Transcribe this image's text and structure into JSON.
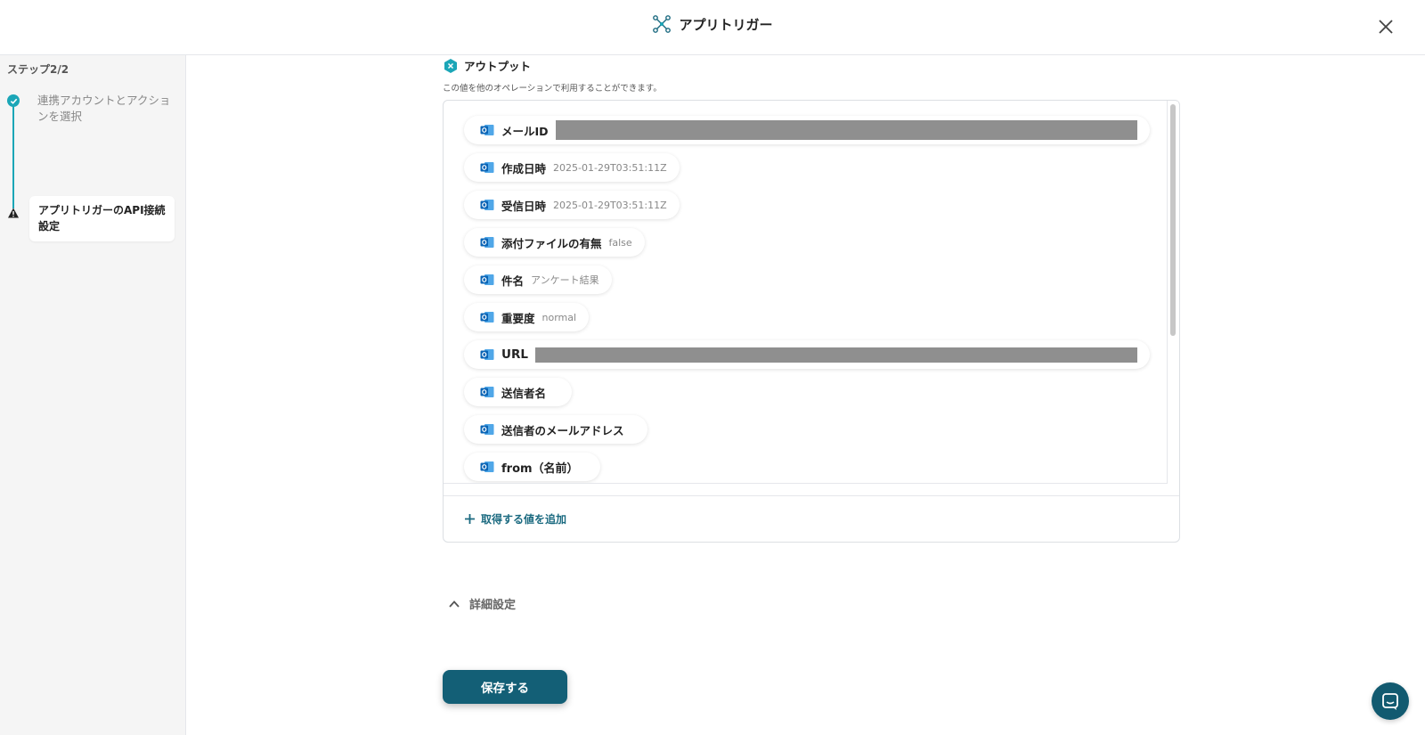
{
  "header": {
    "title": "アプリトリガー",
    "title_icon": "app-trigger-icon",
    "close_icon": "close-icon"
  },
  "sidebar": {
    "step_count": "ステップ2/2",
    "steps": [
      {
        "label": "連携アカウントとアクションを選択",
        "status": "completed",
        "icon": "check-icon"
      },
      {
        "label": "アプリトリガーのAPI接続設定",
        "status": "current",
        "icon": "warning-icon"
      }
    ]
  },
  "output": {
    "title": "アウトプット",
    "description": "この値を他のオペレーションで利用することができます。",
    "items": [
      {
        "label": "メールID",
        "value": "",
        "redacted": true
      },
      {
        "label": "作成日時",
        "value": "2025-01-29T03:51:11Z"
      },
      {
        "label": "受信日時",
        "value": "2025-01-29T03:51:11Z"
      },
      {
        "label": "添付ファイルの有無",
        "value": "false"
      },
      {
        "label": "件名",
        "value": "アンケート結果"
      },
      {
        "label": "重要度",
        "value": "normal"
      },
      {
        "label": "URL",
        "value": "",
        "redacted": true
      },
      {
        "label": "送信者名",
        "value": ""
      },
      {
        "label": "送信者のメールアドレス",
        "value": ""
      },
      {
        "label": "from（名前）",
        "value": ""
      }
    ],
    "add_label": "取得する値を追加"
  },
  "details": {
    "label": "詳細設定"
  },
  "save_label": "保存する",
  "colors": {
    "accent": "#1ba6b7",
    "primary": "#135f76",
    "link": "#1b6a80",
    "outlook_blue": "#0a64b5"
  }
}
